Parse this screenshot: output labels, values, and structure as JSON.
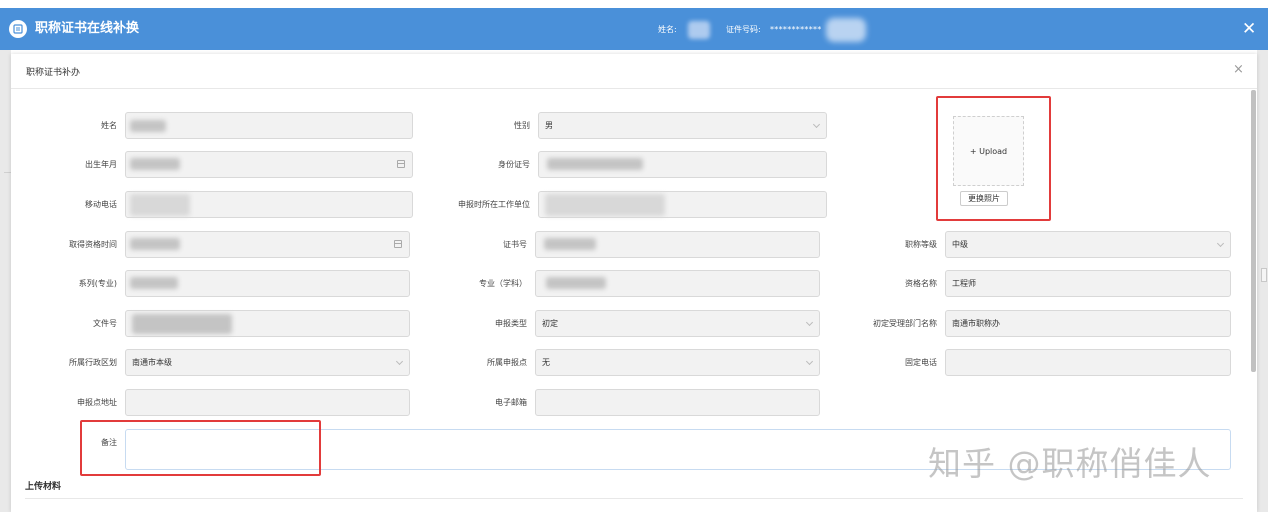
{
  "header": {
    "title": "职称证书在线补换",
    "name_label": "姓名:",
    "cert_label": "证件号码:",
    "cert_value": "************",
    "close_glyph": "✕",
    "color": "#4a90d9"
  },
  "dialog": {
    "title": "职称证书补办",
    "close_glyph": "×"
  },
  "form": {
    "name": {
      "label": "姓名"
    },
    "gender": {
      "label": "性别",
      "value": "男"
    },
    "birth": {
      "label": "出生年月"
    },
    "id_number": {
      "label": "身份证号"
    },
    "mobile": {
      "label": "移动电话"
    },
    "employer": {
      "label": "申报时所在工作单位"
    },
    "qual_date": {
      "label": "取得资格时间"
    },
    "cert_no": {
      "label": "证书号"
    },
    "title_level": {
      "label": "职称等级",
      "value": "中级"
    },
    "series": {
      "label": "系列(专业)"
    },
    "major": {
      "label": "专业（学科）"
    },
    "qual_name": {
      "label": "资格名称",
      "value": "工程师"
    },
    "doc_no": {
      "label": "文件号"
    },
    "apply_type": {
      "label": "申报类型",
      "value": "初定"
    },
    "dept": {
      "label": "初定受理部门名称",
      "value": "南通市职称办"
    },
    "district": {
      "label": "所属行政区划",
      "value": "南通市本级"
    },
    "apply_point": {
      "label": "所属申报点",
      "value": "无"
    },
    "phone": {
      "label": "固定电话"
    },
    "address": {
      "label": "申报点地址"
    },
    "email": {
      "label": "电子邮箱"
    },
    "remark": {
      "label": "备注"
    }
  },
  "photo": {
    "upload_label": "+ Upload",
    "change_label": "更换照片"
  },
  "section": {
    "upload_materials": "上传材料"
  },
  "watermark": "知乎 @职称俏佳人",
  "highlight_color": "#e23b3b"
}
